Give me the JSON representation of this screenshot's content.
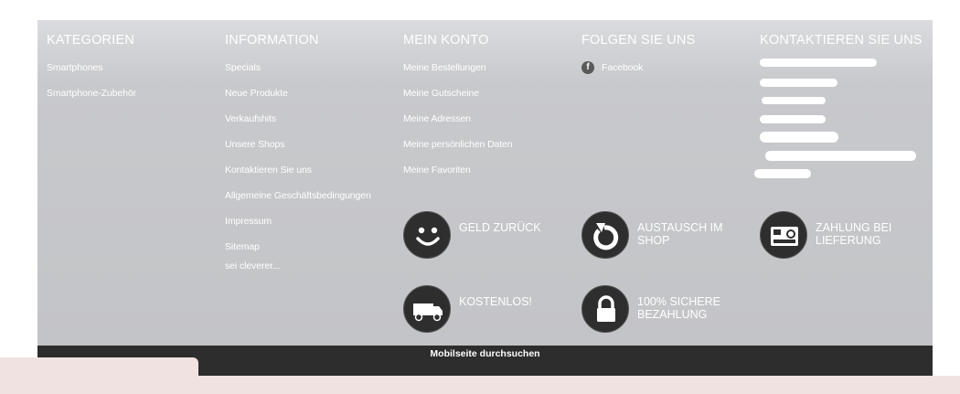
{
  "columns": {
    "kategorien": {
      "title": "KATEGORIEN",
      "links": [
        "Smartphones",
        "Smartphone-Zubehör"
      ]
    },
    "information": {
      "title": "INFORMATION",
      "links": [
        "Specials",
        "Neue Produkte",
        "Verkaufshits",
        "Unsere Shops",
        "Kontaktieren Sie uns",
        "Allgemeine Geschäftsbedingungen",
        "Impressum",
        "Sitemap",
        "sei cleverer..."
      ]
    },
    "konto": {
      "title": "MEIN KONTO",
      "links": [
        "Meine Bestellungen",
        "Meine Gutscheine",
        "Meine Adressen",
        "Meine persönlichen Daten",
        "Meine Favoriten"
      ]
    },
    "folgen": {
      "title": "FOLGEN SIE UNS",
      "facebook_icon_letter": "f",
      "facebook": "Facebook"
    },
    "kontakt": {
      "title": "KONTAKTIEREN SIE UNS"
    }
  },
  "features": {
    "geld": "GELD ZURÜCK",
    "austausch": "AUSTAUSCH IM SHOP",
    "zahlung": "ZAHLUNG BEI LIEFERUNG",
    "kostenlos": "KOSTENLOS!",
    "sicher": "100% SICHERE BEZAHLUNG"
  },
  "icons": {
    "geld": "smiley-icon",
    "austausch": "refresh-icon",
    "zahlung": "card-terminal-icon",
    "kostenlos": "truck-icon",
    "sicher": "lock-icon",
    "facebook": "facebook-icon"
  },
  "bottom_bar": {
    "search_label": "Mobilseite durchsuchen"
  },
  "colors": {
    "footer_bg": "#c3c4c7",
    "bar_bg": "#2d2d2d",
    "icon_circle": "#2e2e2e",
    "bottom_strip": "#f1e2e2"
  }
}
